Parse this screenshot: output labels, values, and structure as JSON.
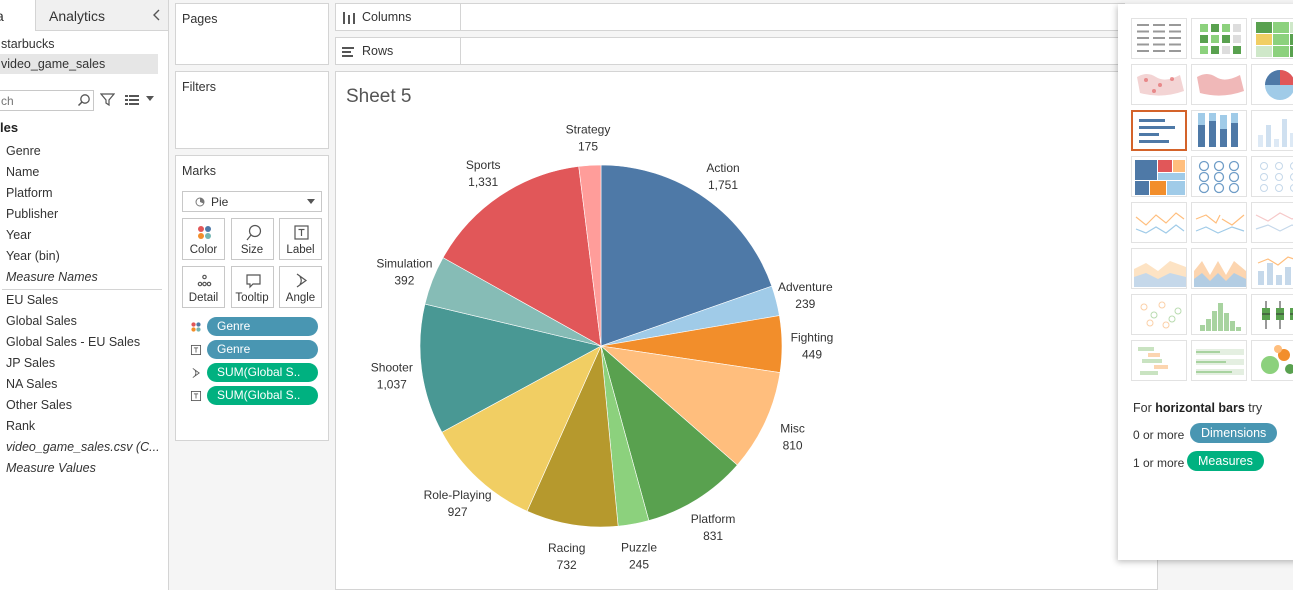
{
  "data_pane": {
    "tabs": [
      "a",
      "Analytics"
    ],
    "data_sources": [
      {
        "label": "starbucks",
        "selected": false
      },
      {
        "label": "video_game_sales",
        "selected": true
      }
    ],
    "search_placeholder": "ch",
    "table_name": "les",
    "fields": [
      {
        "label": "Genre",
        "italic": false
      },
      {
        "label": "Name",
        "italic": false
      },
      {
        "label": "Platform",
        "italic": false
      },
      {
        "label": "Publisher",
        "italic": false
      },
      {
        "label": "Year",
        "italic": false
      },
      {
        "label": "Year (bin)",
        "italic": false
      },
      {
        "label": "Measure Names",
        "italic": true
      },
      {
        "label": "EU Sales",
        "italic": false
      },
      {
        "label": "Global Sales",
        "italic": false
      },
      {
        "label": "Global Sales - EU Sales",
        "italic": false
      },
      {
        "label": "JP Sales",
        "italic": false
      },
      {
        "label": "NA Sales",
        "italic": false
      },
      {
        "label": "Other Sales",
        "italic": false
      },
      {
        "label": "Rank",
        "italic": false
      },
      {
        "label": "video_game_sales.csv (C...",
        "italic": true
      },
      {
        "label": "Measure Values",
        "italic": true
      }
    ]
  },
  "shelves": {
    "pages": "Pages",
    "filters": "Filters",
    "columns": "Columns",
    "rows": "Rows"
  },
  "marks": {
    "title": "Marks",
    "mark_type": "Pie",
    "buttons": [
      {
        "label": "Color",
        "icon": "color-dots-icon"
      },
      {
        "label": "Size",
        "icon": "size-lasso-icon"
      },
      {
        "label": "Label",
        "icon": "text-label-icon"
      },
      {
        "label": "Detail",
        "icon": "detail-dots-icon"
      },
      {
        "label": "Tooltip",
        "icon": "tooltip-bubble-icon"
      },
      {
        "label": "Angle",
        "icon": "angle-icon"
      }
    ],
    "pills": [
      {
        "label": "Genre",
        "kind": "dimension",
        "icon": "color-dots-icon"
      },
      {
        "label": "Genre",
        "kind": "dimension",
        "icon": "text-label-icon"
      },
      {
        "label": "SUM(Global S..",
        "kind": "measure",
        "icon": "angle-icon"
      },
      {
        "label": "SUM(Global S..",
        "kind": "measure",
        "icon": "text-label-icon"
      }
    ]
  },
  "sheet": {
    "title": "Sheet 5"
  },
  "chart_data": {
    "type": "pie",
    "title": "Sheet 5",
    "categories": [
      "Action",
      "Adventure",
      "Fighting",
      "Misc",
      "Platform",
      "Puzzle",
      "Racing",
      "Role-Playing",
      "Shooter",
      "Simulation",
      "Sports",
      "Strategy"
    ],
    "values": [
      1751,
      239,
      449,
      810,
      831,
      245,
      732,
      927,
      1037,
      392,
      1331,
      175
    ],
    "value_labels": [
      "1,751",
      "239",
      "449",
      "810",
      "831",
      "245",
      "732",
      "927",
      "1,037",
      "392",
      "1,331",
      "175"
    ],
    "colors": [
      "#4e79a7",
      "#a0cbe8",
      "#f28e2b",
      "#ffbe7d",
      "#59a14f",
      "#8cd17d",
      "#b6992d",
      "#f1ce63",
      "#499894",
      "#86bcb6",
      "#e15759",
      "#ff9d9a"
    ]
  },
  "show_me": {
    "thumbnails": [
      "text-table",
      "heat-map",
      "highlight-table",
      "symbol-map",
      "filled-map",
      "pie-chart",
      "horizontal-bars",
      "stacked-bars",
      "side-by-side-bars",
      "treemap",
      "circle-views",
      "side-by-side-circles",
      "continuous-lines",
      "discrete-lines",
      "dual-lines",
      "area-continuous",
      "area-discrete",
      "dual-combination",
      "scatter-plot",
      "histogram",
      "box-and-whisker",
      "gantt",
      "bullet-graph",
      "packed-bubbles"
    ],
    "selected": "horizontal-bars",
    "hint_prefix": "For ",
    "hint_bold": "horizontal bars",
    "hint_suffix": " try",
    "dim_count": "0 or more",
    "dim_pill": "Dimensions",
    "meas_count": "1 or more",
    "meas_pill": "Measures"
  },
  "colors": {
    "dimension_pill": "#4996b2",
    "measure_pill": "#00b180",
    "selection": "#d4632a"
  }
}
